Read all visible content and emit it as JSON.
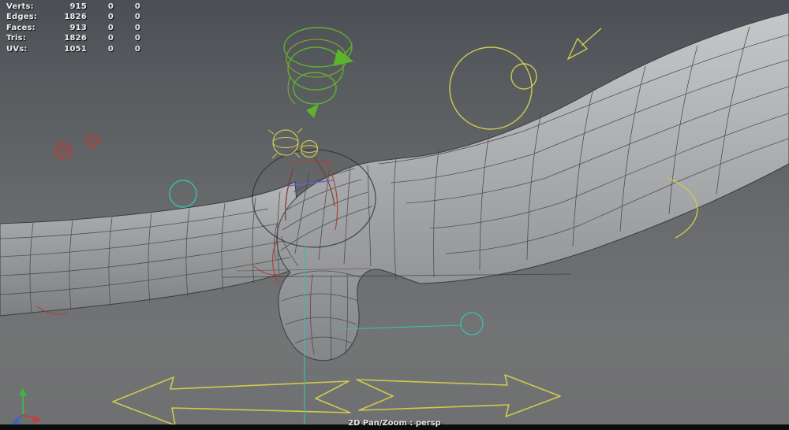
{
  "hud": {
    "rows": [
      {
        "label": "Verts:",
        "count": "915",
        "c2": "0",
        "c3": "0"
      },
      {
        "label": "Edges:",
        "count": "1826",
        "c2": "0",
        "c3": "0"
      },
      {
        "label": "Faces:",
        "count": "913",
        "c2": "0",
        "c3": "0"
      },
      {
        "label": "Tris:",
        "count": "1826",
        "c2": "0",
        "c3": "0"
      },
      {
        "label": "UVs:",
        "count": "1051",
        "c2": "0",
        "c3": "0"
      }
    ]
  },
  "statusbar": {
    "label": "2D Pan/Zoom : persp"
  },
  "colors": {
    "rig_green": "#5cb42c",
    "rig_green_dark": "#7f9d35",
    "rig_yellow": "#cfca4d",
    "rig_teal": "#38c0b2",
    "rig_red": "#a8453c",
    "rig_red_dark": "#83382f",
    "rig_blue": "#6f5fd0",
    "axis_x": "#c24040",
    "axis_y": "#44b044",
    "axis_z": "#4062c8"
  }
}
